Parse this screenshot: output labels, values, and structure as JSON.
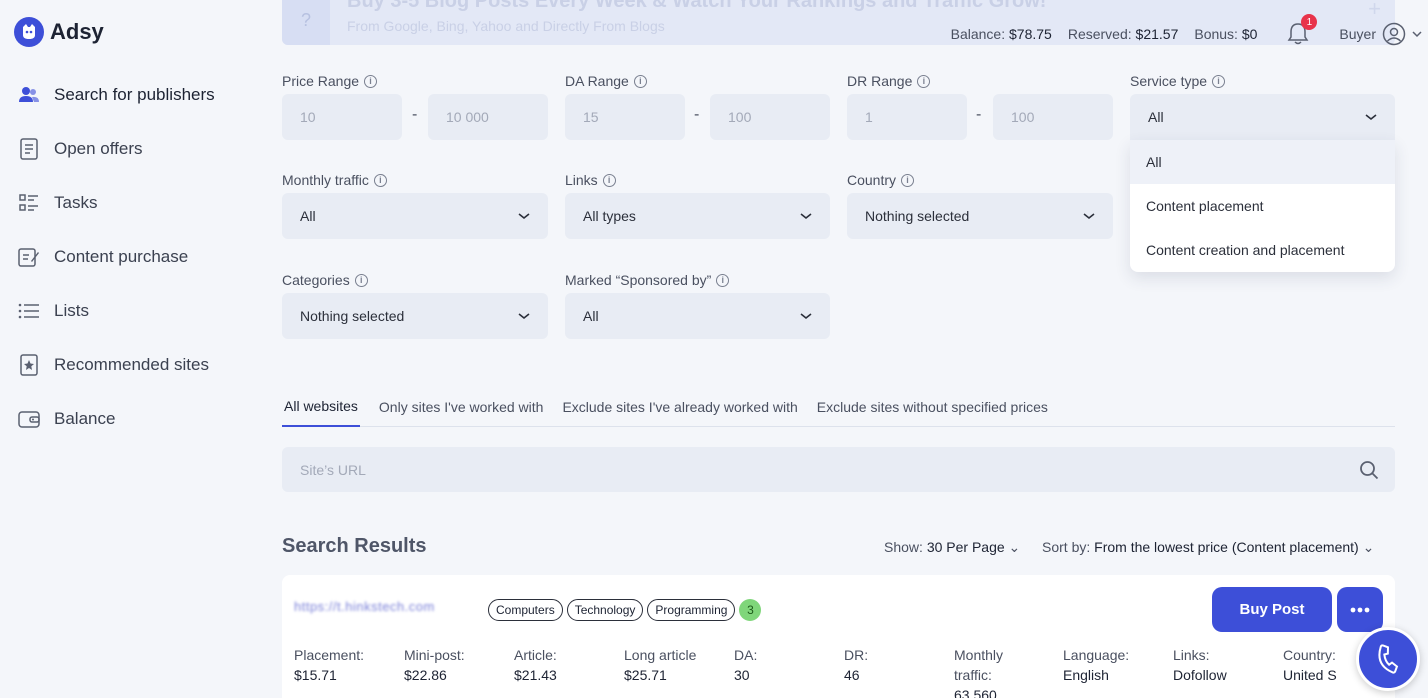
{
  "brand": {
    "name": "Adsy"
  },
  "sidebar": {
    "items": [
      {
        "label": "Search for publishers",
        "icon": "users-icon"
      },
      {
        "label": "Open offers",
        "icon": "document-icon"
      },
      {
        "label": "Tasks",
        "icon": "tasks-icon"
      },
      {
        "label": "Content purchase",
        "icon": "edit-document-icon"
      },
      {
        "label": "Lists",
        "icon": "list-icon"
      },
      {
        "label": "Recommended sites",
        "icon": "star-bookmark-icon"
      },
      {
        "label": "Balance",
        "icon": "wallet-icon"
      }
    ]
  },
  "banner": {
    "title": "Buy 3-5 Blog Posts Every Week & Watch Your Rankings and Traffic Grow!",
    "subtitle": "From Google, Bing, Yahoo and Directly From Blogs"
  },
  "topbar": {
    "balance_label": "Balance:",
    "balance_value": "$78.75",
    "reserved_label": "Reserved:",
    "reserved_value": "$21.57",
    "bonus_label": "Bonus:",
    "bonus_value": "$0",
    "notifications": "1",
    "role": "Buyer"
  },
  "filters": {
    "price": {
      "label": "Price Range",
      "min": "10",
      "max": "10 000"
    },
    "da": {
      "label": "DA Range",
      "min": "15",
      "max": "100"
    },
    "dr": {
      "label": "DR Range",
      "min": "1",
      "max": "100"
    },
    "service_type": {
      "label": "Service type",
      "value": "All",
      "options": [
        "All",
        "Content placement",
        "Content creation and placement"
      ]
    },
    "monthly_traffic": {
      "label": "Monthly traffic",
      "value": "All"
    },
    "links": {
      "label": "Links",
      "value": "All types"
    },
    "country": {
      "label": "Country",
      "value": "Nothing selected"
    },
    "categories": {
      "label": "Categories",
      "value": "Nothing selected"
    },
    "sponsored": {
      "label": "Marked “Sponsored by”",
      "value": "All"
    },
    "range_separator": "-"
  },
  "tabs": [
    "All websites",
    "Only sites I've worked with",
    "Exclude sites I've already worked with",
    "Exclude sites without specified prices"
  ],
  "search": {
    "placeholder": "Site’s URL"
  },
  "results": {
    "title": "Search Results",
    "show_label": "Show:",
    "show_value": "30 Per Page",
    "sort_label": "Sort by:",
    "sort_value": "From the lowest price (Content placement)"
  },
  "card": {
    "url": "https://t.hinkstech.com",
    "categories": [
      "Computers",
      "Technology",
      "Programming"
    ],
    "extra_count": "3",
    "buy_label": "Buy Post",
    "metrics": [
      {
        "label": "Placement:",
        "value": "$15.71"
      },
      {
        "label": "Mini-post:",
        "value": "$22.86"
      },
      {
        "label": "Article:",
        "value": "$21.43"
      },
      {
        "label": "Long article",
        "value": "$25.71"
      },
      {
        "label": "DA:",
        "value": "30"
      },
      {
        "label": "DR:",
        "value": "46"
      },
      {
        "label": "Monthly traffic:",
        "value": "63 560"
      },
      {
        "label": "Language:",
        "value": "English"
      },
      {
        "label": "Links:",
        "value": "Dofollow"
      },
      {
        "label": "Country:",
        "value": "United S"
      }
    ]
  },
  "colors": {
    "accent": "#3d4fd8",
    "badge": "#e8334a",
    "chip_count": "#7fd67a"
  }
}
